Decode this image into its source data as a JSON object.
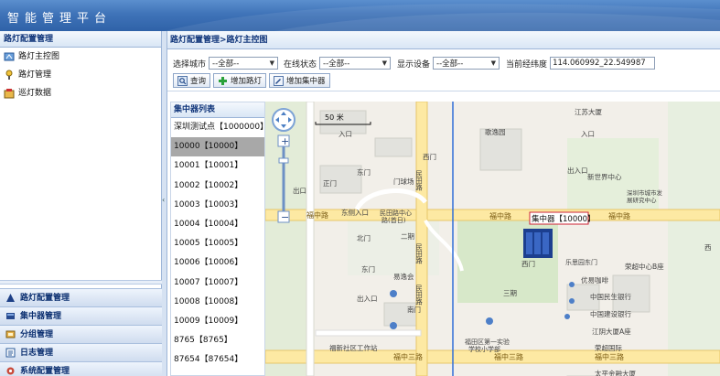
{
  "app": {
    "title": "智能管理平台"
  },
  "sidebar": {
    "title": "路灯配置管理",
    "items": [
      {
        "label": "路灯主控图",
        "icon": "map-icon"
      },
      {
        "label": "路灯管理",
        "icon": "lamp-icon"
      },
      {
        "label": "巡灯数据",
        "icon": "patrol-icon"
      }
    ],
    "accordion": [
      {
        "label": "路灯配置管理",
        "icon": "triangle-icon"
      },
      {
        "label": "集中器管理",
        "icon": "device-icon"
      },
      {
        "label": "分组管理",
        "icon": "group-icon"
      },
      {
        "label": "日志管理",
        "icon": "log-icon"
      },
      {
        "label": "系统配置管理",
        "icon": "settings-icon"
      }
    ]
  },
  "main": {
    "breadcrumb": "路灯配置管理>路灯主控图",
    "filters": {
      "city_label": "选择城市",
      "city_value": "--全部--",
      "status_label": "在线状态",
      "status_value": "--全部--",
      "device_label": "显示设备",
      "device_value": "--全部--",
      "coord_label": "当前经纬度",
      "coord_value": "114.060992_22.549987"
    },
    "buttons": {
      "query": "查询",
      "add_lamp": "增加路灯",
      "add_concentrator": "增加集中器"
    },
    "list": {
      "title": "集中器列表",
      "items": [
        "深圳测试点【1000000】",
        "10000【10000】",
        "10001【10001】",
        "10002【10002】",
        "10003【10003】",
        "10004【10004】",
        "10005【10005】",
        "10006【10006】",
        "10007【10007】",
        "10008【10008】",
        "10009【10009】",
        "8765【8765】",
        "87654【87654】"
      ],
      "selected_index": 1
    },
    "map": {
      "scale_label": "50 米",
      "marker_label": "集中器【10000】",
      "road_labels": [
        "福中路",
        "福中路",
        "福中路",
        "福中三路",
        "福中三路",
        "福中三路",
        "民田路",
        "民田路",
        "民田路"
      ],
      "place_labels": [
        "江苏大厦",
        "新世界中心",
        "深圳市城市发展研究中心",
        "荣超中心B座",
        "优易咖啡",
        "中国民生银行",
        "中国建设银行",
        "江阴大厦A座",
        "荣超国际",
        "太平金融大厦",
        "二期",
        "三期",
        "民田路中心路(首日)",
        "福新社区工作站",
        "福田区第一实验学校小学部",
        "歌逸园",
        "易逸会",
        "门球场",
        "出入口",
        "入口",
        "东门",
        "西门",
        "南门",
        "北门",
        "正门",
        "东侧入口",
        "出口",
        "乐思园东门"
      ]
    }
  },
  "colors": {
    "header": "#3f73b8",
    "accent": "#10357a",
    "selected": "#a8a8a8"
  }
}
